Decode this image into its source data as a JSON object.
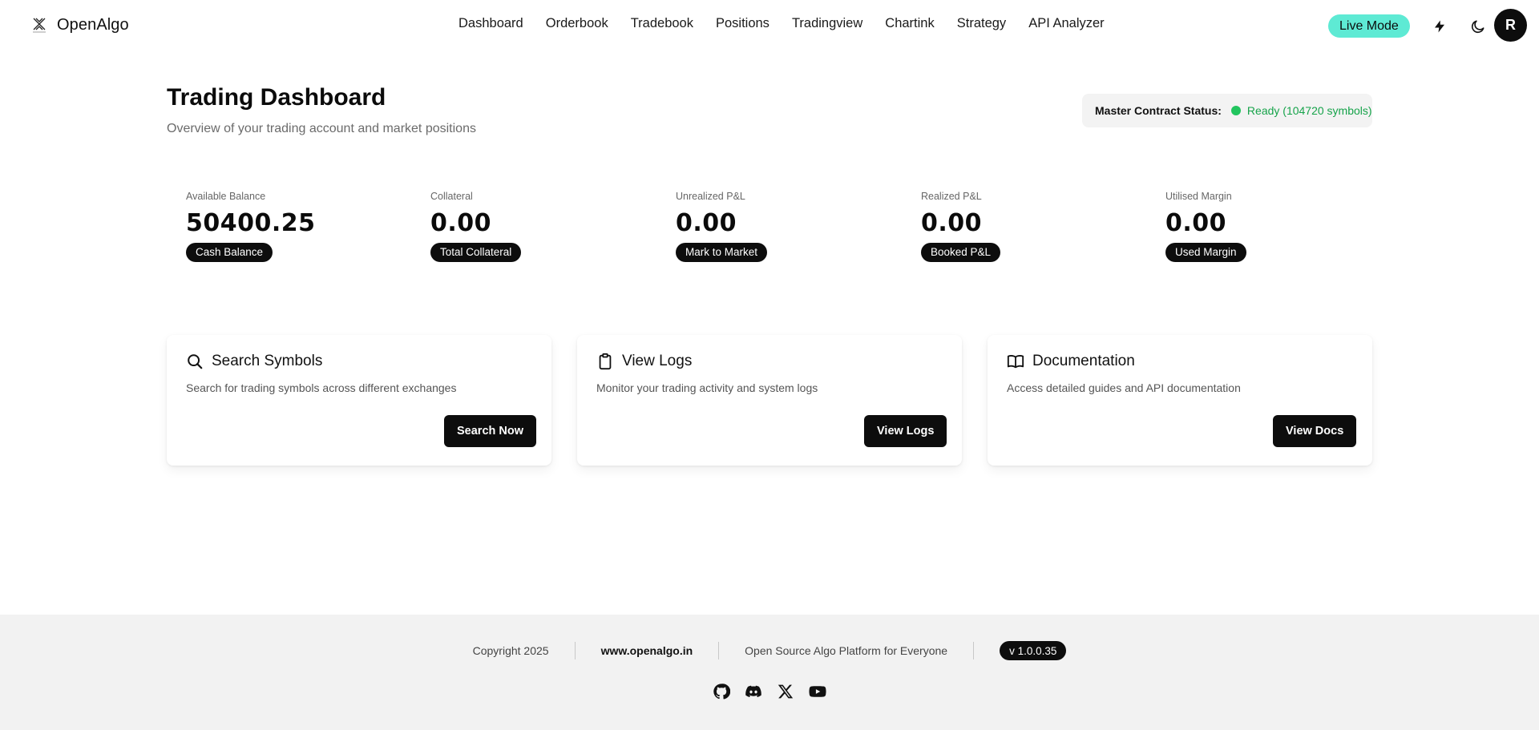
{
  "brand": {
    "name": "OpenAlgo",
    "logo_icon": "openalgo-logo-icon"
  },
  "nav": {
    "links": [
      "Dashboard",
      "Orderbook",
      "Tradebook",
      "Positions",
      "Tradingview",
      "Chartink",
      "Strategy",
      "API Analyzer"
    ],
    "mode_badge": "Live Mode",
    "icons": [
      "lightning-icon",
      "moon-icon"
    ],
    "avatar_initial": "R"
  },
  "header": {
    "title": "Trading Dashboard",
    "subtitle": "Overview of your trading account and market positions",
    "status_label": "Master Contract Status:",
    "status_text": "Ready (104720 symbols)",
    "status_color": "#22c55e"
  },
  "stats": [
    {
      "label": "Available Balance",
      "value": "50400.25",
      "badge": "Cash Balance"
    },
    {
      "label": "Collateral",
      "value": "0.00",
      "badge": "Total Collateral"
    },
    {
      "label": "Unrealized P&L",
      "value": "0.00",
      "badge": "Mark to Market"
    },
    {
      "label": "Realized P&L",
      "value": "0.00",
      "badge": "Booked P&L"
    },
    {
      "label": "Utilised Margin",
      "value": "0.00",
      "badge": "Used Margin"
    }
  ],
  "cards": [
    {
      "icon": "search-icon",
      "title": "Search Symbols",
      "description": "Search for trading symbols across different exchanges",
      "button": "Search Now"
    },
    {
      "icon": "clipboard-icon",
      "title": "View Logs",
      "description": "Monitor your trading activity and system logs",
      "button": "View Logs"
    },
    {
      "icon": "book-icon",
      "title": "Documentation",
      "description": "Access detailed guides and API documentation",
      "button": "View Docs"
    }
  ],
  "footer": {
    "copyright": "Copyright 2025",
    "website": "www.openalgo.in",
    "tagline": "Open Source Algo Platform for Everyone",
    "version": "v 1.0.0.35",
    "social_icons": [
      "github-icon",
      "discord-icon",
      "x-icon",
      "youtube-icon"
    ]
  },
  "colors": {
    "accent": "#5eead4",
    "primary": "#0d0d0d",
    "success": "#22c55e"
  }
}
